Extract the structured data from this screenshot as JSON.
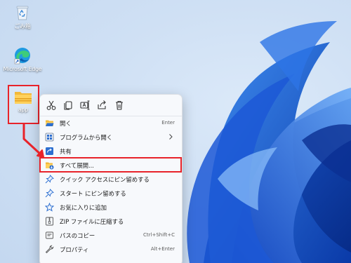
{
  "desktop": {
    "icons": [
      {
        "label": "ごみ箱",
        "icon": "recycle-bin-icon"
      },
      {
        "label": "Microsoft Edge",
        "icon": "edge-icon"
      },
      {
        "label": "app",
        "icon": "zip-folder-icon"
      }
    ]
  },
  "context_menu": {
    "toolbar": [
      "cut-icon",
      "copy-icon",
      "rename-icon",
      "share-icon",
      "delete-icon"
    ],
    "items": [
      {
        "label": "開く",
        "shortcut": "Enter",
        "icon": "open-folder-icon"
      },
      {
        "label": "プログラムから開く",
        "shortcut": "",
        "icon": "open-with-icon",
        "submenu": true
      },
      {
        "label": "共有",
        "shortcut": "",
        "icon": "share-icon"
      },
      {
        "label": "すべて展開...",
        "shortcut": "",
        "icon": "extract-all-icon",
        "highlighted": true
      },
      {
        "label": "クイック アクセスにピン留めする",
        "shortcut": "",
        "icon": "pin-icon"
      },
      {
        "label": "スタート にピン留めする",
        "shortcut": "",
        "icon": "pin-icon"
      },
      {
        "label": "お気に入りに追加",
        "shortcut": "",
        "icon": "star-icon"
      },
      {
        "label": "ZIP ファイルに圧縮する",
        "shortcut": "",
        "icon": "zip-icon"
      },
      {
        "label": "パスのコピー",
        "shortcut": "Ctrl+Shift+C",
        "icon": "copy-path-icon"
      },
      {
        "label": "プロパティ",
        "shortcut": "Alt+Enter",
        "icon": "properties-icon"
      }
    ]
  },
  "colors": {
    "annotation_red": "#e8232a",
    "accent_blue": "#2563c9"
  }
}
